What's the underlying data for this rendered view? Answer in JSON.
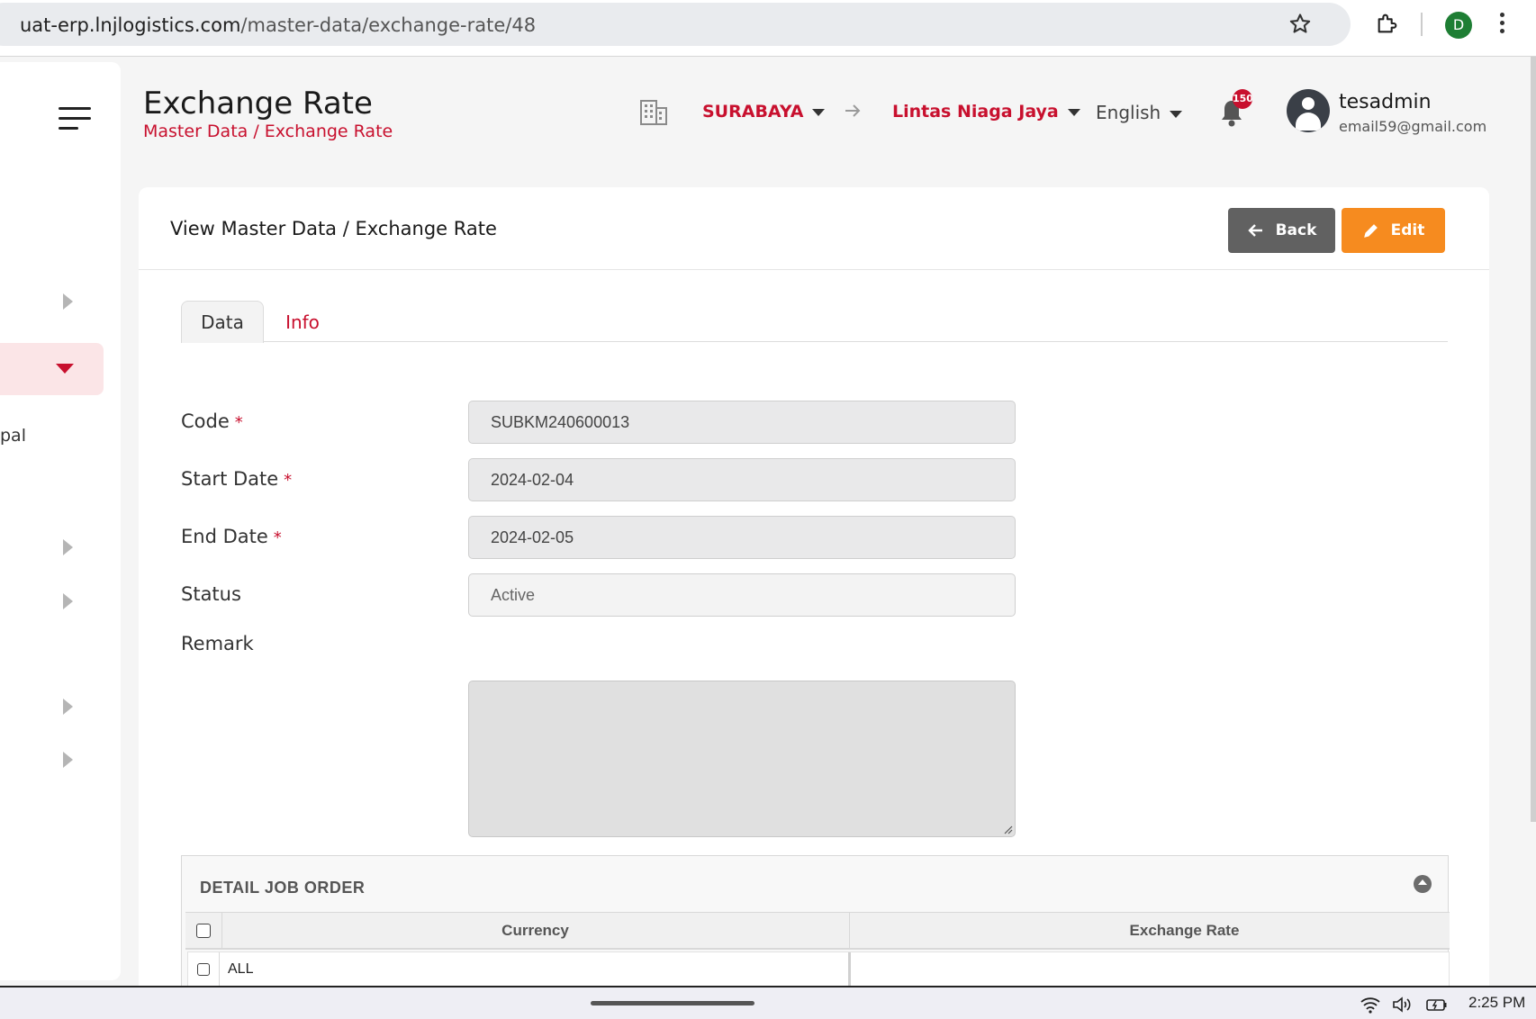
{
  "browser": {
    "url_host": "uat-erp.lnjlogistics.com",
    "url_path": "/master-data/exchange-rate/48",
    "profile_initial": "D"
  },
  "sidebar": {
    "partial_text": "pal"
  },
  "header": {
    "title": "Exchange Rate",
    "breadcrumb": "Master Data / Exchange Rate",
    "branch": "SURABAYA",
    "company": "Lintas Niaga Jaya",
    "language": "English",
    "notification_count": "150",
    "user_name": "tesadmin",
    "user_email": "email59@gmail.com"
  },
  "card": {
    "title": "View Master Data / Exchange Rate",
    "back_label": "Back",
    "edit_label": "Edit",
    "tabs": [
      "Data",
      "Info"
    ]
  },
  "form": {
    "code_label": "Code",
    "code_value": "SUBKM240600013",
    "start_date_label": "Start Date",
    "start_date_value": "2024-02-04",
    "end_date_label": "End Date",
    "end_date_value": "2024-02-05",
    "status_label": "Status",
    "status_value": "Active",
    "remark_label": "Remark",
    "required_mark": "*"
  },
  "detail": {
    "title": "DETAIL JOB ORDER",
    "columns": [
      "Currency",
      "Exchange Rate"
    ],
    "rows": [
      {
        "currency": "ALL",
        "rate": ""
      }
    ]
  },
  "taskbar": {
    "time": "2:25 PM"
  },
  "colors": {
    "brand_red": "#c8102e",
    "edit_orange": "#f68b1f",
    "back_gray": "#616161"
  }
}
